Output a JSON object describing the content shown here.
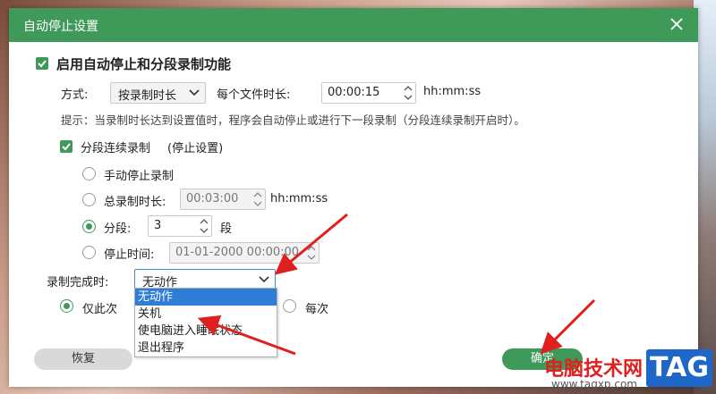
{
  "dialog": {
    "title": "自动停止设置",
    "enable_label": "启用自动停止和分段录制功能",
    "mode_label": "方式:",
    "mode_value": "按录制时长",
    "per_file_label": "每个文件时长:",
    "per_file_value": "00:00:15",
    "per_file_unit": "hh:mm:ss",
    "hint": "提示：当录制时长达到设置值时，程序会自动停止或进行下一段录制（分段连续录制开启时）。",
    "segment_label": "分段连续录制",
    "stop_settings_label": "(停止设置)",
    "options": {
      "manual": "手动停止录制",
      "total_label": "总录制时长:",
      "total_value": "00:03:00",
      "total_unit": "hh:mm:ss",
      "segments_label": "分段:",
      "segments_value": "3",
      "segments_unit": "段",
      "stop_time_label": "停止时间:",
      "stop_time_value": "01-01-2000 00:00:00"
    },
    "on_complete_label": "录制完成时:",
    "on_complete_value": "无动作",
    "on_complete_options": [
      "无动作",
      "关机",
      "使电脑进入睡眠状态",
      "退出程序"
    ],
    "once_label": "仅此次",
    "every_label": "每次",
    "restore_button": "恢复",
    "ok_button": "确定"
  },
  "watermark": {
    "text": "电脑技术网",
    "url": "www.tagxp.com",
    "tag": "TAG"
  },
  "colors": {
    "accent": "#3f9a5a",
    "selection": "#2f7dd6",
    "arrow": "#e02020"
  }
}
